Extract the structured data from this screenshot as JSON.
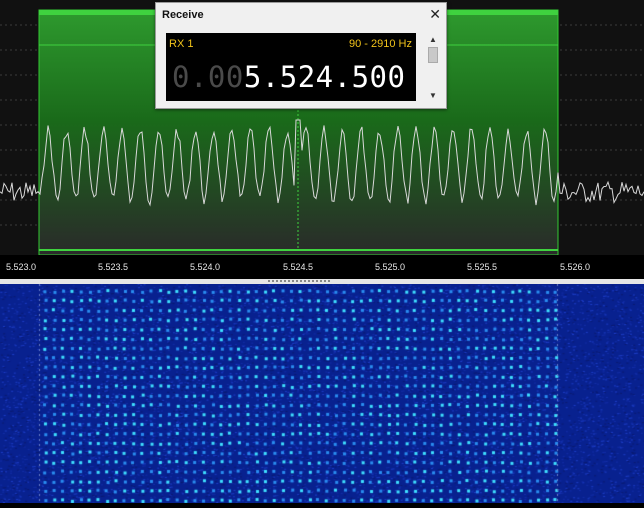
{
  "receive": {
    "title": "Receive",
    "close_glyph": "✕",
    "rx_label": "RX 1",
    "bandwidth": "90 - 2910 Hz",
    "frequency_dim": "0.00",
    "frequency_bright": "5.524.500",
    "scroll_up_glyph": "▲",
    "scroll_down_glyph": "▼"
  },
  "axis": {
    "ticks": [
      "5.523.0",
      "5.523.5",
      "5.524.0",
      "5.524.5",
      "5.525.0",
      "5.525.5",
      "5.526.0"
    ]
  },
  "colors": {
    "passband": "#1d8a1d",
    "passband_edge": "#33cc33",
    "trace": "#d9d9d9",
    "waterfall_bg": "#061c8a",
    "waterfall_hot": "#3fe0ff"
  }
}
